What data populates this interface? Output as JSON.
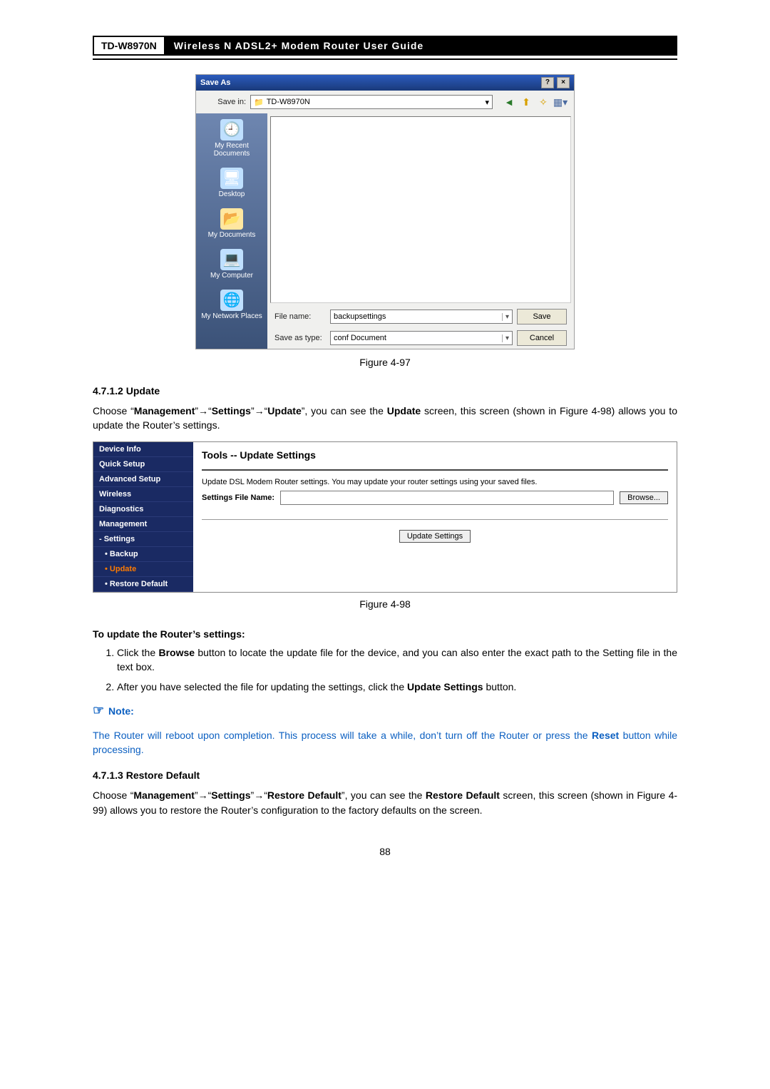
{
  "header": {
    "model": "TD-W8970N",
    "title": "Wireless N ADSL2+ Modem Router User Guide"
  },
  "saveas": {
    "title": "Save As",
    "saveIn_label": "Save in:",
    "saveIn_value": "TD-W8970N",
    "places": [
      "My Recent Documents",
      "Desktop",
      "My Documents",
      "My Computer",
      "My Network Places"
    ],
    "filename_label": "File name:",
    "filename_value": "backupsettings",
    "saveastype_label": "Save as type:",
    "saveastype_value": "conf Document",
    "save_btn": "Save",
    "cancel_btn": "Cancel"
  },
  "fig97": "Figure 4-97",
  "sec_update_num": "4.7.1.2  Update",
  "update_para_a": "Choose “",
  "update_para_b": "Management",
  "update_para_c": "”",
  "update_para_d": "“",
  "update_para_e": "Settings",
  "update_para_f": "”",
  "update_para_g": "“",
  "update_para_h": "Update",
  "update_para_i": "”, you can see the ",
  "update_para_j": "Update",
  "update_para_k": " screen, this screen (shown in Figure 4-98) allows you to update the Router’s settings.",
  "nav": [
    "Device Info",
    "Quick Setup",
    "Advanced Setup",
    "Wireless",
    "Diagnostics",
    "Management",
    "- Settings",
    "• Backup",
    "• Update",
    "• Restore Default"
  ],
  "tools_title": "Tools -- Update Settings",
  "tools_desc": "Update DSL Modem Router settings. You may update your router settings using your saved files.",
  "sfname_label": "Settings File Name:",
  "browse_btn": "Browse...",
  "update_btn": "Update Settings",
  "fig98": "Figure 4-98",
  "howto_title": "To update the Router’s settings:",
  "howto_1a": "Click the ",
  "howto_1b": "Browse",
  "howto_1c": " button to locate the update file for the device, and you can also enter the exact path to the Setting file in the text box.",
  "howto_2a": "After you have selected the file for updating the settings, click the ",
  "howto_2b": "Update Settings",
  "howto_2c": " button.",
  "note_label": "Note:",
  "note_a": "The Router will reboot upon completion. This process will take a while, don’t turn off the Router or press the ",
  "note_b": "Reset",
  "note_c": " button while processing.",
  "sec_restore_num": "4.7.1.3  Restore Default",
  "restore_a": "Choose “",
  "restore_b": "Management",
  "restore_c": "”",
  "restore_d": "“",
  "restore_e": "Settings",
  "restore_f": "”",
  "restore_g": "“",
  "restore_h": "Restore Default",
  "restore_i": "”, you can see the ",
  "restore_j": "Restore Default",
  "restore_k": " screen, this screen (shown in Figure 4-99) allows you to restore the Router’s configuration to the factory defaults on the screen.",
  "pgnum": "88"
}
